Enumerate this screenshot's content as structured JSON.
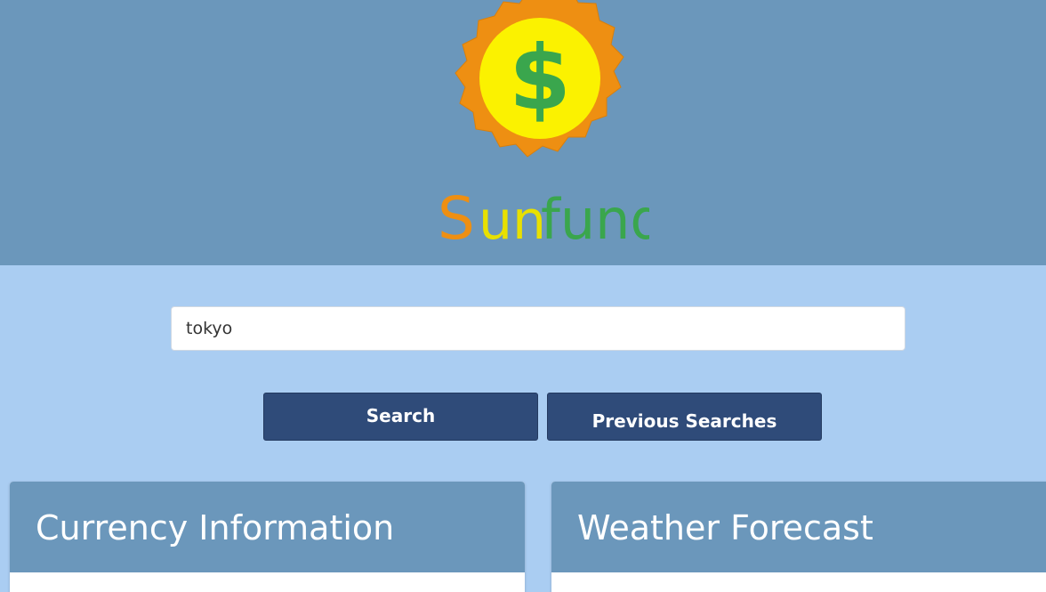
{
  "header": {
    "logo_text": "Sunfund",
    "logo_symbol": "$",
    "colors": {
      "background": "#6b97bb",
      "sun_rays": "#ee8f12",
      "sun_core": "#fbf200",
      "dollar": "#3aa64d"
    }
  },
  "search": {
    "value": "tokyo",
    "placeholder": ""
  },
  "buttons": {
    "search_label": "Search",
    "previous_label": "Previous Searches"
  },
  "cards": {
    "currency_title": "Currency Information",
    "weather_title": "Weather Forecast"
  },
  "colors": {
    "page_background": "#aacdf2",
    "button": "#2f4b79",
    "card_header": "#6b97bb"
  }
}
